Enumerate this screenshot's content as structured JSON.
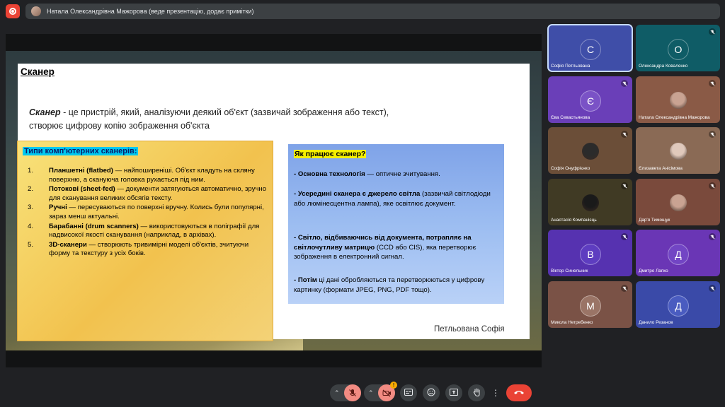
{
  "topbar": {
    "presenter_text": "Натала Олександрівна Мажорова (веде презентацію, додає примітки)"
  },
  "slide": {
    "title": "Сканер",
    "definition_term": "Сканер",
    "definition_rest": " - це пристрій, який, аналізуючи деякий об'єкт (зазвичай зображення або текст), створює цифрову копію зображення об'єкта",
    "types_title": "Типи комп'ютерних сканерів:",
    "types": [
      {
        "num": "1.",
        "bold": "Планшетні (flatbed)",
        "text": " — найпоширеніші. Об'єкт кладуть на скляну поверхню, а скануюча головка рухається під ним."
      },
      {
        "num": "2.",
        "bold": "Потокові (sheet-fed)",
        "text": " — документи затягуються автоматично, зручно для сканування великих обсягів тексту."
      },
      {
        "num": "3.",
        "bold": "Ручні",
        "text": " — пересуваються по поверхні вручну. Колись були популярні, зараз менш актуальні."
      },
      {
        "num": "4.",
        "bold": "Барабанні (drum scanners)",
        "text": " — використовуються в поліграфії для надвисокої якості сканування (наприклад, в архівах)."
      },
      {
        "num": "5.",
        "bold": "3D-сканери",
        "text": " — створюють тривимірні моделі об'єктів, зчитуючи форму та текстуру з усіх боків."
      }
    ],
    "how_title": "Як працює сканер?",
    "how": [
      {
        "bold": "- Основна технологія",
        "text": " — оптичне зчитування."
      },
      {
        "bold": "- Усередині сканера є джерело світла",
        "text": " (зазвичай світлодіоди або люмінесцентна лампа), яке освітлює документ."
      },
      {
        "bold": "- Світло, відбиваючись від документа, потрапляє на світлочутливу матрицю",
        "text": " (CCD або CIS), яка перетворює зображення в електронний сигнал."
      },
      {
        "bold": "- Потім",
        "text": " ці дані обробляються та перетворюються у цифрову картинку (формати JPEG, PNG, PDF тощо)."
      }
    ],
    "signature": "Петльована Софія"
  },
  "participants": [
    {
      "name": "Софія Петльована",
      "initial": "С",
      "bg": "#3f4ea8",
      "circle": "#3f4ea8",
      "muted": false,
      "active": true,
      "photo": false
    },
    {
      "name": "Олександра Коваленко",
      "initial": "О",
      "bg": "#0f5c66",
      "circle": "#0f5c66",
      "muted": true,
      "active": false,
      "photo": false
    },
    {
      "name": "Єва Севастьянова",
      "initial": "Є",
      "bg": "#6a3fb8",
      "circle": "#7a52c6",
      "muted": true,
      "active": false,
      "photo": false
    },
    {
      "name": "Натала Олександрівна Мажорова",
      "initial": "",
      "bg": "#8a5a46",
      "circle": "#c9a392",
      "muted": true,
      "active": false,
      "photo": true
    },
    {
      "name": "Софія Онуфрієнко",
      "initial": "",
      "bg": "#6b4e38",
      "circle": "#2b2b2b",
      "muted": true,
      "active": false,
      "photo": true
    },
    {
      "name": "Єлизавета Анісімова",
      "initial": "",
      "bg": "#8a6a55",
      "circle": "#e0c9bc",
      "muted": true,
      "active": false,
      "photo": true
    },
    {
      "name": "Анастасія Компанієць",
      "initial": "",
      "bg": "#403a24",
      "circle": "#1a1a1a",
      "muted": true,
      "active": false,
      "photo": true
    },
    {
      "name": "Дар'я Тимощук",
      "initial": "",
      "bg": "#7a4a3c",
      "circle": "#c9a392",
      "muted": true,
      "active": false,
      "photo": true
    },
    {
      "name": "Віктор Синельник",
      "initial": "В",
      "bg": "#5632b0",
      "circle": "#5e3dc0",
      "muted": true,
      "active": false,
      "photo": false
    },
    {
      "name": "Дмитро Лапко",
      "initial": "Д",
      "bg": "#6a36b5",
      "circle": "#7245c4",
      "muted": true,
      "active": false,
      "photo": false
    },
    {
      "name": "Микола Нетребенко",
      "initial": "М",
      "bg": "#7a5246",
      "circle": "#9a7466",
      "muted": true,
      "active": false,
      "photo": false
    },
    {
      "name": "Данило Резанов",
      "initial": "Д",
      "bg": "#3a4aa8",
      "circle": "#4a5cc0",
      "muted": true,
      "active": false,
      "photo": false
    }
  ],
  "controls": {
    "camera_badge": "!"
  },
  "icons": {
    "record": "record-icon",
    "mic_off": "mic-off-icon",
    "camera_off": "camera-off-icon",
    "captions": "captions-icon",
    "emoji": "emoji-icon",
    "present": "present-icon",
    "raise_hand": "raise-hand-icon",
    "more": "more-icon",
    "end_call": "end-call-icon"
  }
}
